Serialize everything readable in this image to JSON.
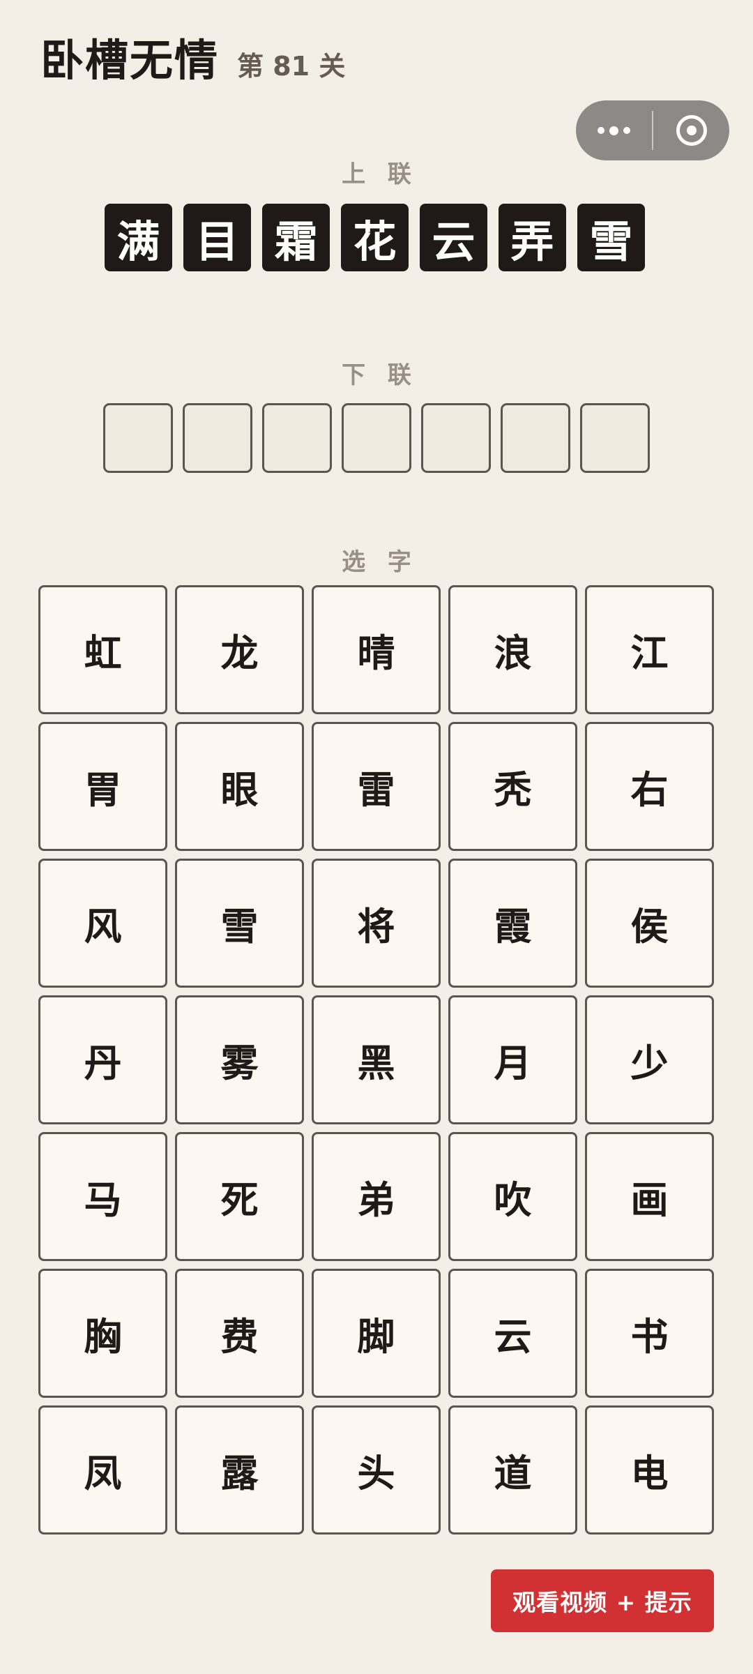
{
  "header": {
    "title": "卧槽无情",
    "level": "第 81 关"
  },
  "capsule": {
    "more_icon": "more-dots-icon",
    "close_icon": "target-circle-icon"
  },
  "upper": {
    "label": "上 联",
    "chars": [
      "满",
      "目",
      "霜",
      "花",
      "云",
      "弄",
      "雪"
    ]
  },
  "lower": {
    "label": "下 联",
    "slots": [
      "",
      "",
      "",
      "",
      "",
      "",
      ""
    ]
  },
  "picker": {
    "label": "选 字",
    "chars": [
      "虹",
      "龙",
      "晴",
      "浪",
      "江",
      "胃",
      "眼",
      "雷",
      "秃",
      "右",
      "风",
      "雪",
      "将",
      "霞",
      "侯",
      "丹",
      "雾",
      "黑",
      "月",
      "少",
      "马",
      "死",
      "弟",
      "吹",
      "画",
      "胸",
      "费",
      "脚",
      "云",
      "书",
      "凤",
      "露",
      "头",
      "道",
      "电"
    ]
  },
  "hint_button": {
    "label": "观看视频 + 提示"
  },
  "colors": {
    "background": "#f4efe6",
    "upper_tile": "#1f1a17",
    "hint_button": "#d23133"
  }
}
